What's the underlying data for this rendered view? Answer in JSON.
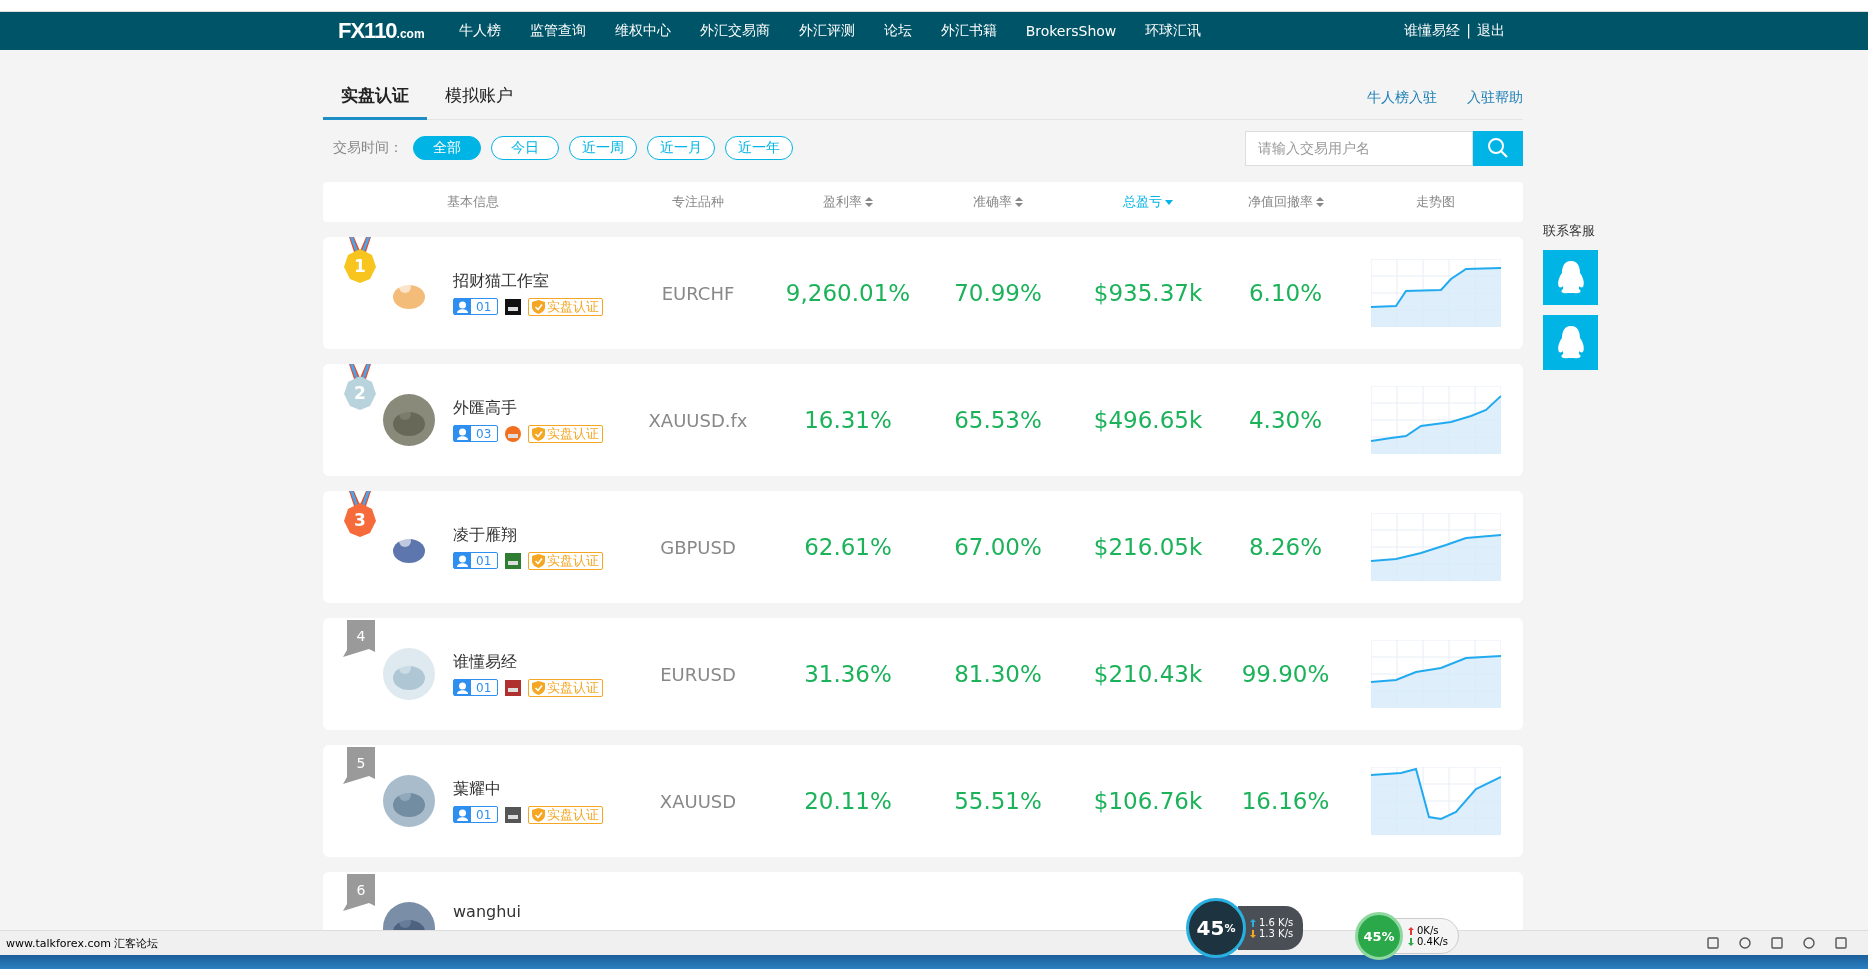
{
  "nav": {
    "logo": "FX110",
    "logo_suffix": ".com",
    "items": [
      {
        "label": "牛人榜",
        "selected": false
      },
      {
        "label": "监管查询",
        "selected": false
      },
      {
        "label": "维权中心",
        "selected": false
      },
      {
        "label": "外汇交易商",
        "selected": false
      },
      {
        "label": "外汇评测",
        "selected": false
      },
      {
        "label": "论坛",
        "selected": false
      },
      {
        "label": "外汇书籍",
        "selected": false
      },
      {
        "label": "BrokersShow",
        "selected": false
      },
      {
        "label": "环球汇讯",
        "selected": false
      }
    ],
    "user": "谁懂易经",
    "separator": "|",
    "logout": "退出"
  },
  "tabs": [
    {
      "label": "实盘认证",
      "selected": true
    },
    {
      "label": "模拟账户",
      "selected": false
    }
  ],
  "top_links": [
    "牛人榜入驻",
    "入驻帮助"
  ],
  "filter": {
    "label": "交易时间：",
    "options": [
      {
        "label": "全部",
        "selected": true
      },
      {
        "label": "今日",
        "selected": false
      },
      {
        "label": "近一周",
        "selected": false
      },
      {
        "label": "近一月",
        "selected": false
      },
      {
        "label": "近一年",
        "selected": false
      }
    ]
  },
  "search": {
    "placeholder": "请输入交易用户名"
  },
  "table": {
    "columns": [
      {
        "label": "基本信息",
        "sortable": false,
        "selected": false
      },
      {
        "label": "专注品种",
        "sortable": false,
        "selected": false
      },
      {
        "label": "盈利率",
        "sortable": true,
        "selected": false
      },
      {
        "label": "准确率",
        "sortable": true,
        "selected": false
      },
      {
        "label": "总盈亏",
        "sortable": true,
        "selected": true
      },
      {
        "label": "净值回撤率",
        "sortable": true,
        "selected": false
      },
      {
        "label": "走势图",
        "sortable": false,
        "selected": false
      }
    ],
    "rows": [
      {
        "rank": "1",
        "kind": "medal",
        "color": "#f7c51e",
        "name": "招财猫工作室",
        "accounts": "01",
        "certified": "实盘认证",
        "product": "EURCHF",
        "profit": "9,260.01%",
        "accuracy": "70.99%",
        "total": "$935.37k",
        "drawdown": "6.10%"
      },
      {
        "rank": "2",
        "kind": "medal",
        "color": "#b9d3dc",
        "name": "外匯高手",
        "accounts": "03",
        "certified": "实盘认证",
        "product": "XAUUSD.fx",
        "profit": "16.31%",
        "accuracy": "65.53%",
        "total": "$496.65k",
        "drawdown": "4.30%"
      },
      {
        "rank": "3",
        "kind": "medal",
        "color": "#f56b3c",
        "name": "凌于雁翔",
        "accounts": "01",
        "certified": "实盘认证",
        "product": "GBPUSD",
        "profit": "62.61%",
        "accuracy": "67.00%",
        "total": "$216.05k",
        "drawdown": "8.26%"
      },
      {
        "rank": "4",
        "kind": "ribbon",
        "color": "#9a9a9a",
        "name": "谁懂易经",
        "accounts": "01",
        "certified": "实盘认证",
        "product": "EURUSD",
        "profit": "31.36%",
        "accuracy": "81.30%",
        "total": "$210.43k",
        "drawdown": "99.90%"
      },
      {
        "rank": "5",
        "kind": "ribbon",
        "color": "#9a9a9a",
        "name": "葉耀中",
        "accounts": "01",
        "certified": "实盘认证",
        "product": "XAUUSD",
        "profit": "20.11%",
        "accuracy": "55.51%",
        "total": "$106.76k",
        "drawdown": "16.16%"
      },
      {
        "rank": "6",
        "kind": "ribbon",
        "color": "#9a9a9a",
        "name": "wanghui"
      }
    ]
  },
  "service": {
    "title": "联系客服"
  },
  "status_bar": {
    "text": "www.talkforex.com 汇客论坛"
  },
  "widgets": [
    {
      "percent": "45",
      "unit": "%",
      "up": "1.6 K/s",
      "down": "1.3 K/s"
    },
    {
      "percent": "45%",
      "up": "0K/s",
      "down": "0.4K/s"
    }
  ]
}
